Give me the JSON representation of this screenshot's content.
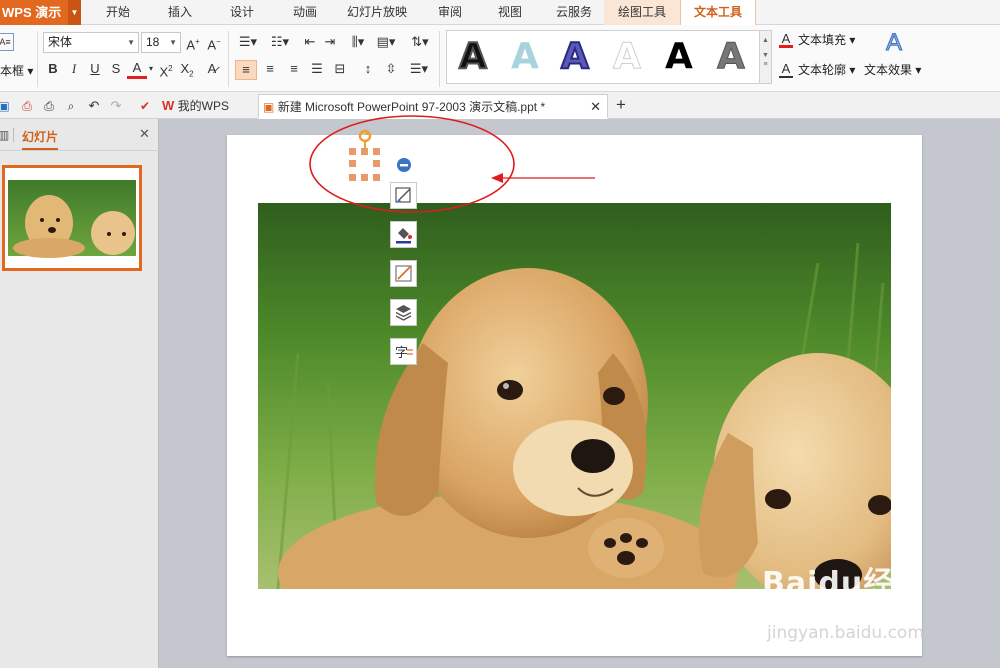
{
  "app": {
    "name": "WPS 演示"
  },
  "menu": {
    "tabs": [
      "开始",
      "插入",
      "设计",
      "动画",
      "幻灯片放映",
      "审阅",
      "视图",
      "云服务",
      "绘图工具",
      "文本工具"
    ]
  },
  "ribbon": {
    "textbox_label": "本框",
    "font_name": "宋体",
    "font_size": "18",
    "text_fill": "文本填充",
    "text_outline": "文本轮廓",
    "text_effect": "文本效果",
    "wordart_glyph": "A",
    "colors": {
      "accent": "#e2671f",
      "text_fill_bar": "#e02020",
      "wordart_black": "#111111",
      "wordart_teal": "#a9d3dc",
      "wordart_navy": "#3c3c9a"
    }
  },
  "doc_tabs": [
    {
      "label": "我的WPS"
    },
    {
      "label": "新建 Microsoft PowerPoint 97-2003 演示文稿.ppt *"
    }
  ],
  "left_pane": {
    "tab_label": "幻灯片"
  },
  "watermark": {
    "brand": "Baidu经验",
    "url": "jingyan.baidu.com"
  },
  "icons": [
    "save-icon",
    "undo-icon",
    "redo-icon",
    "print-icon",
    "close-icon",
    "add-tab-icon",
    "rotate-handle-icon",
    "minus-circle-icon",
    "edit-style-icon",
    "fill-icon",
    "outline-icon",
    "layers-icon",
    "text-wrap-icon",
    "arrow-annotation"
  ]
}
